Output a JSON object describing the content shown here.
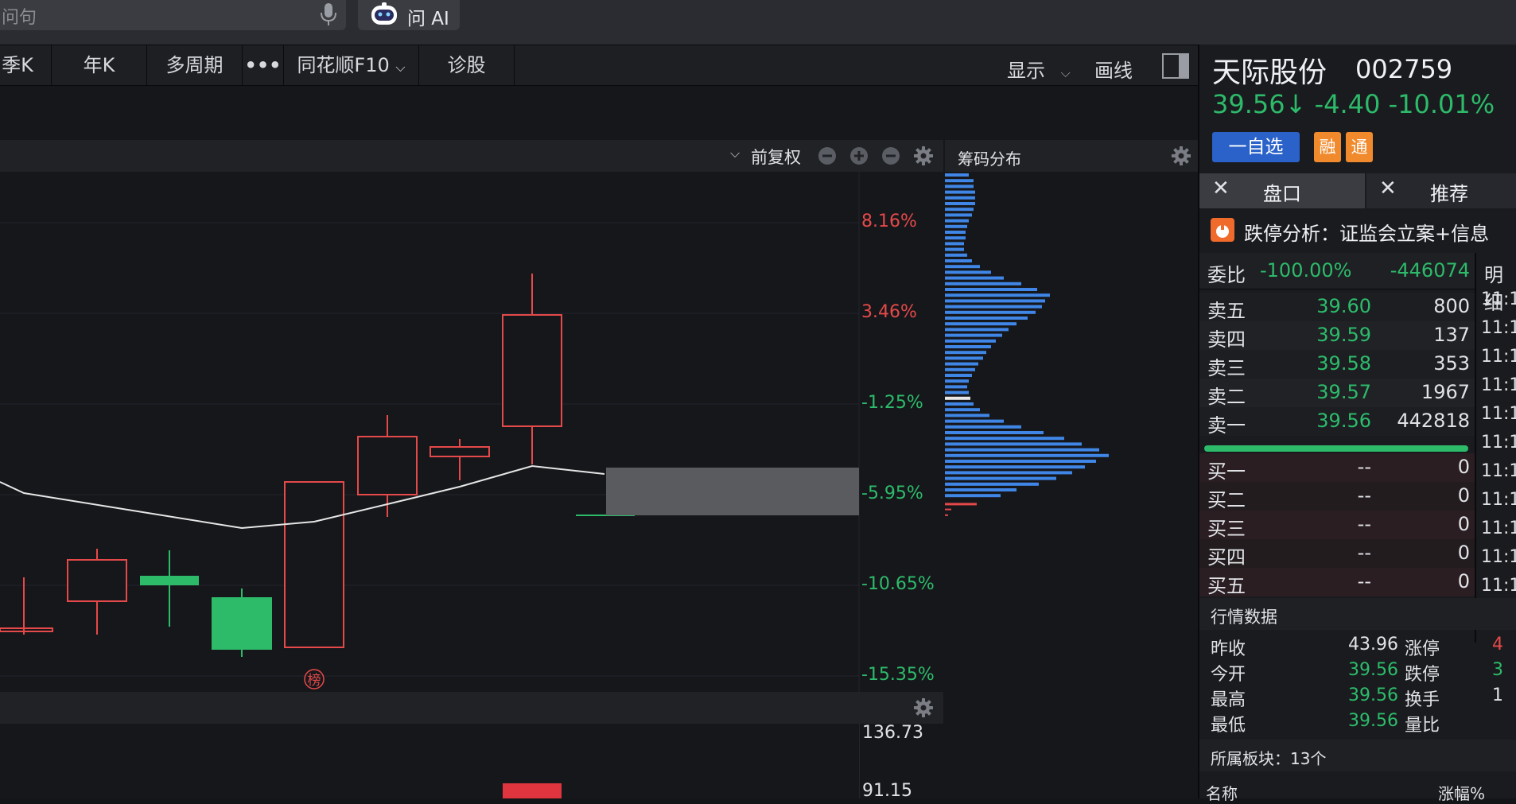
{
  "search": {
    "placeholder_partial": "问句"
  },
  "ask_ai": {
    "label": "问 AI"
  },
  "tabs": [
    "季K",
    "年K",
    "多周期",
    "•••",
    "同花顺F10",
    "诊股"
  ],
  "toolbar": {
    "display_label": "显示",
    "draw_label": "画线"
  },
  "main_chart": {
    "adjust_label": "前复权",
    "percent_ticks": [
      {
        "label": "8.16%",
        "color": "#e54949"
      },
      {
        "label": "3.46%",
        "color": "#e54949"
      },
      {
        "label": "-1.25%",
        "color": "#2dbb6a"
      },
      {
        "label": "-5.95%",
        "color": "#2dbb6a"
      },
      {
        "label": "-10.65%",
        "color": "#2dbb6a"
      },
      {
        "label": "-15.35%",
        "color": "#2dbb6a"
      }
    ],
    "bang_marker": "榜"
  },
  "chip_panel": {
    "title": "筹码分布"
  },
  "volume_chart": {
    "ticks": [
      "136.73",
      "91.15"
    ]
  },
  "stock": {
    "name": "天际股份",
    "code": "002759",
    "price": "39.56↓",
    "change": "-4.40",
    "change_pct": "-10.01%",
    "watchlist_label": "一自选",
    "badge_margin": "融",
    "badge_connect": "通"
  },
  "panel_tabs": [
    "盘口",
    "推荐"
  ],
  "limit_notice": "跌停分析：证监会立案+信息",
  "order_book": {
    "ratio_label": "委比",
    "ratio_pct": "-100.00%",
    "ratio_diff": "-446074",
    "detail_label": "明细",
    "asks": [
      {
        "name": "卖五",
        "price": "39.60",
        "volume": "800"
      },
      {
        "name": "卖四",
        "price": "39.59",
        "volume": "137"
      },
      {
        "name": "卖三",
        "price": "39.58",
        "volume": "353"
      },
      {
        "name": "卖二",
        "price": "39.57",
        "volume": "1967"
      },
      {
        "name": "卖一",
        "price": "39.56",
        "volume": "442818"
      }
    ],
    "bids": [
      {
        "name": "买一",
        "price": "--",
        "volume": "0"
      },
      {
        "name": "买二",
        "price": "--",
        "volume": "0"
      },
      {
        "name": "买三",
        "price": "--",
        "volume": "0"
      },
      {
        "name": "买四",
        "price": "--",
        "volume": "0"
      },
      {
        "name": "买五",
        "price": "--",
        "volume": "0"
      }
    ],
    "times": [
      "11:1",
      "11:1",
      "11:1",
      "11:1",
      "11:1",
      "11:1",
      "11:1",
      "11:1",
      "11:1",
      "11:1",
      "11:1"
    ]
  },
  "quote_data": {
    "title": "行情数据",
    "rows": [
      {
        "k": "昨收",
        "v": "43.96",
        "k2": "涨停",
        "v2": "4"
      },
      {
        "k": "今开",
        "v": "39.56",
        "k2": "跌停",
        "v2": "3"
      },
      {
        "k": "最高",
        "v": "39.56",
        "k2": "换手",
        "v2": "1"
      },
      {
        "k": "最低",
        "v": "39.56",
        "k2": "量比",
        "v2": ""
      }
    ]
  },
  "sector": {
    "label": "所属板块：13个",
    "col_name": "名称",
    "col_change": "涨幅%"
  }
}
